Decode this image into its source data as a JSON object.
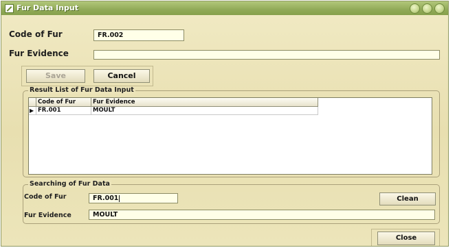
{
  "window": {
    "title": "Fur Data Input"
  },
  "form": {
    "code_label": "Code of Fur",
    "code_value": "FR.002",
    "evidence_label": "Fur Evidence",
    "evidence_value": "",
    "save_label": "Save",
    "cancel_label": "Cancel"
  },
  "results": {
    "group_title": "Result List of Fur Data Input",
    "columns": [
      "Code of Fur",
      "Fur Evidence"
    ],
    "rows": [
      {
        "indicator": "▶",
        "code": "FR.001",
        "evidence": "MOULT"
      }
    ]
  },
  "search": {
    "group_title": "Searching of Fur Data",
    "code_label": "Code of Fur",
    "code_value": "FR.001",
    "evidence_label": "Fur Evidence",
    "evidence_value": "MOULT",
    "clean_label": "Clean"
  },
  "footer": {
    "close_label": "Close"
  },
  "colors": {
    "titlebar": "#91aa58",
    "background": "#ece4b6",
    "field": "#ffffe8"
  }
}
